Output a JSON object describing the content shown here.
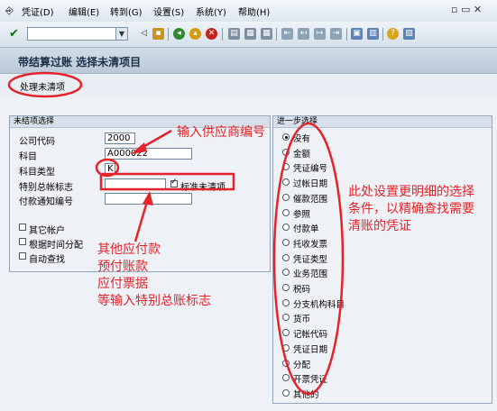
{
  "menu": [
    "凭证(D)",
    "编辑(E)",
    "转到(G)",
    "设置(S)",
    "系统(Y)",
    "帮助(H)"
  ],
  "title": "带结算过账 选择未清项目",
  "app_toolbar": {
    "process_open_items": "处理未清项"
  },
  "open_item_selection": {
    "header": "未结项选择",
    "company_code_label": "公司代码",
    "company_code_value": "2000",
    "account_label": "科目",
    "account_value": "A000022",
    "account_type_label": "科目类型",
    "account_type_value": "K",
    "special_gl_label": "特别总帐标志",
    "special_gl_value": "",
    "standard_open_label": "标准未清项",
    "payment_advice_label": "付款通知编号",
    "payment_advice_value": "",
    "other_accounts_label": "其它帐户",
    "distribute_by_age_label": "根据时间分配",
    "auto_search_label": "自动查找"
  },
  "further_selection": {
    "header": "进一步选择",
    "options": [
      "没有",
      "金额",
      "凭证编号",
      "过帐日期",
      "催款范围",
      "参照",
      "付款单",
      "托收发票",
      "凭证类型",
      "业务范围",
      "税码",
      "分支机构科目",
      "货币",
      "记帐代码",
      "凭证日期",
      "分配",
      "开票凭证",
      "其他的"
    ],
    "selected_index": 0
  },
  "annotations": {
    "enter_vendor": "输入供应商编号",
    "special_gl_note": [
      "其他应付款",
      "预付账款",
      "应付票据",
      "等输入特别总账标志"
    ],
    "further_note": [
      "此处设置更明细的选择",
      "条件，以精确查找需要",
      "清账的凭证"
    ]
  },
  "colors": {
    "annotation": "#e5232a"
  }
}
